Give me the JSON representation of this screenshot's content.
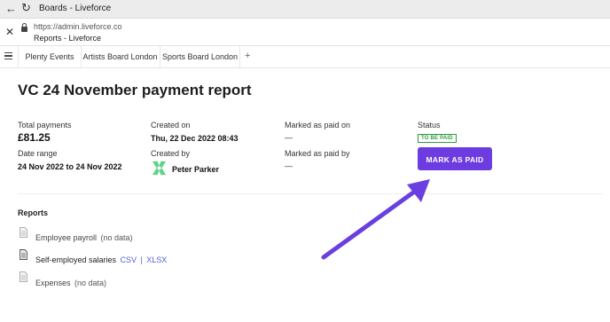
{
  "browser": {
    "title": "Boards - Liveforce",
    "url": "https://admin.liveforce.co",
    "url_subtitle": "Reports - Liveforce"
  },
  "tabs": [
    {
      "label": "Plenty Events"
    },
    {
      "label": "Artists Board London"
    },
    {
      "label": "Sports Board London"
    }
  ],
  "tab_plus": "+",
  "page": {
    "title": "VC 24 November payment report"
  },
  "summary": {
    "total_payments_label": "Total payments",
    "total_payments_value": "£81.25",
    "date_range_label": "Date range",
    "date_range_value": "24 Nov 2022 to 24 Nov 2022",
    "created_on_label": "Created on",
    "created_on_value": "Thu, 22 Dec 2022 08:43",
    "created_by_label": "Created by",
    "created_by_value": "Peter Parker",
    "marked_paid_on_label": "Marked as paid on",
    "marked_paid_on_value": "—",
    "marked_paid_by_label": "Marked as paid by",
    "marked_paid_by_value": "—",
    "status_label": "Status",
    "status_badge": "TO BE PAID",
    "mark_paid_button": "MARK AS PAID"
  },
  "reports": {
    "heading": "Reports",
    "items": [
      {
        "name": "Employee payroll",
        "note": "(no data)"
      },
      {
        "name": "Self-employed salaries",
        "link_csv": "CSV",
        "separator": "|",
        "link_xlsx": "XLSX"
      },
      {
        "name": "Expenses",
        "note": "(no data)"
      }
    ]
  },
  "colors": {
    "accent": "#6d3ce0",
    "status_green": "#2e9e3e",
    "link": "#5563d9",
    "arrow": "#6a3fe0"
  }
}
